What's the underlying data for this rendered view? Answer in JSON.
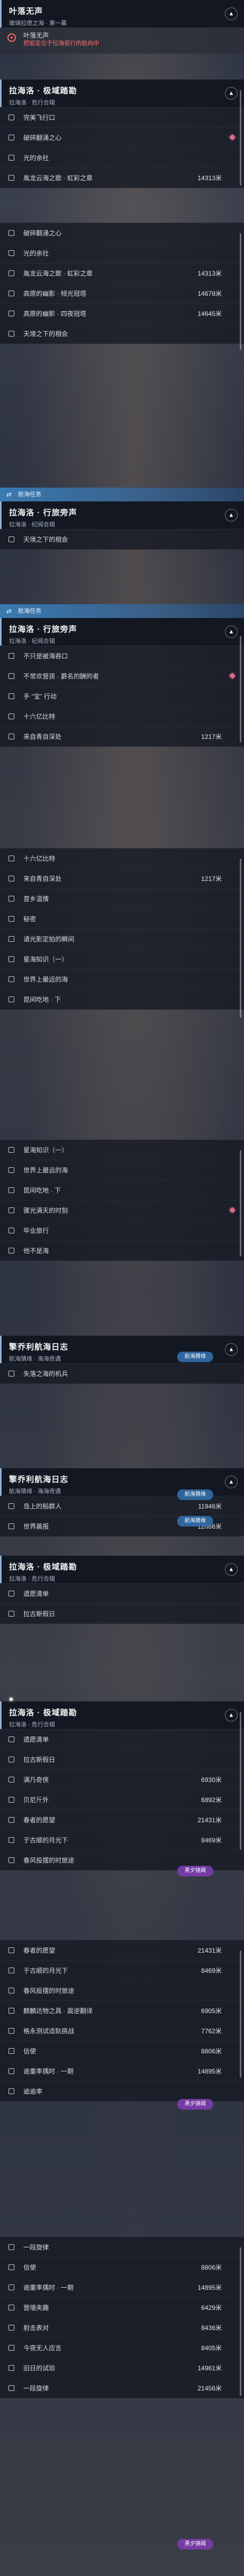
{
  "block1": {
    "title": "叶落无声",
    "subtitle": "玻璃拉德之海 · 第一幕",
    "rows": [
      {
        "label": "叶落无声",
        "sub": "把船定位于拉海若行的航向中",
        "type": "ring"
      },
      {
        "label": "",
        "type": "spacer"
      }
    ]
  },
  "block2": {
    "title": "拉海洛 · 极域踏勘",
    "subtitle": "拉海洛 · 危行合辑",
    "rows": [
      {
        "label": "完美飞行口"
      },
      {
        "label": "破碎翻涌之心",
        "diamond": true
      },
      {
        "label": "光的余社"
      },
      {
        "label": "胤龙云海之歌 · 虹彩之章",
        "dist": "14313米"
      }
    ]
  },
  "block3": {
    "rows": [
      {
        "label": "破碎翻涌之心"
      },
      {
        "label": "光的余社"
      },
      {
        "label": "胤龙云海之歌 · 虹彩之章",
        "dist": "14313米"
      },
      {
        "label": "高原的幽影 · 倾光冠塔",
        "dist": "14678米"
      },
      {
        "label": "高原的幽影 · 四夜冠塔",
        "dist": "14645米"
      },
      {
        "label": "天境之下的相会"
      }
    ]
  },
  "tag1": "航海任务",
  "block4": {
    "title": "拉海洛 · 行旅旁声",
    "subtitle": "拉海洛 · 纪闻合辑",
    "rows": [
      {
        "label": "天境之下的相会"
      }
    ]
  },
  "tag2": "航海任务",
  "block5": {
    "title": "拉海洛 · 行旅旁声",
    "subtitle": "拉海洛 · 纪闻合辑",
    "rows": [
      {
        "label": "不只是被海吞口"
      },
      {
        "label": "不常欢营孩 · 爵名的酬的者",
        "diamond": true
      },
      {
        "label": "手 “宝” 行动"
      },
      {
        "label": "十六亿比特"
      },
      {
        "label": "来自青自深处",
        "dist": "1217米"
      }
    ]
  },
  "block6": {
    "rows": [
      {
        "label": "十六亿比特"
      },
      {
        "label": "来自青自深处",
        "dist": "1217米"
      },
      {
        "label": "昔乡温情"
      },
      {
        "label": "秘密"
      },
      {
        "label": "请光影定拍的瞬间"
      },
      {
        "label": "星海知识（一）"
      },
      {
        "label": "世界上最远的海"
      },
      {
        "label": "昆间吃地 · 下"
      }
    ]
  },
  "block7": {
    "rows": [
      {
        "label": "星海知识（一）"
      },
      {
        "label": "世界上最远的海"
      },
      {
        "label": "昆间吃地 · 下"
      },
      {
        "label": "骤光满天的时刻",
        "diamond": true
      },
      {
        "label": "毕业旅行"
      },
      {
        "label": "他不是海"
      }
    ]
  },
  "block8": {
    "title": "擎乔利航海日志",
    "subtitle": "航海猜缘 · 海海奇遇",
    "badge": "航海猜缘",
    "rows": [
      {
        "label": "失落之海的机兵"
      }
    ]
  },
  "block9": {
    "title": "擎乔利航海日志",
    "subtitle": "航海猜缘 · 海海奇遇",
    "badge1": "航海猜缘",
    "badge2": "航海猜缘",
    "rows": [
      {
        "label": "岛上的船群人",
        "dist": "11946米"
      },
      {
        "label": "世界晨报",
        "dist": "12066米"
      }
    ]
  },
  "block10": {
    "title": "拉海洛 · 极域踏勘",
    "subtitle": "拉海洛 · 危行合辑",
    "rows": [
      {
        "label": "遗愿清单"
      },
      {
        "label": "拉古斯假日"
      }
    ]
  },
  "block11": {
    "title": "拉海洛 · 极域踏勘",
    "subtitle": "拉海洛 · 危行合辑",
    "badge": "黑夕镜阈",
    "rows": [
      {
        "label": "遗愿清单"
      },
      {
        "label": "拉古斯假日"
      },
      {
        "label": "满乃奇侠",
        "dist": "6930米"
      },
      {
        "label": "贝尼斤外",
        "dist": "6892米"
      },
      {
        "label": "春者的愿望",
        "dist": "21431米"
      },
      {
        "label": "于古顺的月光下",
        "dist": "8469米"
      },
      {
        "label": "春风投摆的时旅途"
      }
    ]
  },
  "block12": {
    "badge": "黑夕镜阈",
    "rows": [
      {
        "label": "春者的愿望",
        "dist": "21431米"
      },
      {
        "label": "于古顺的月光下",
        "dist": "8469米"
      },
      {
        "label": "春风投摆的时旅途"
      },
      {
        "label": "麒麟达物之具 · 腐逆翻译",
        "dist": "6905米"
      },
      {
        "label": "格永测试适轨挑战",
        "dist": "7762米"
      },
      {
        "label": "信使",
        "dist": "8806米"
      },
      {
        "label": "逾重率偶时 · 一期",
        "dist": "14895米"
      },
      {
        "label": "逾逾率"
      }
    ]
  },
  "block13": {
    "badge": "黑夕镜阈",
    "rows": [
      {
        "label": "一段旋律"
      },
      {
        "label": "信使",
        "dist": "8806米"
      },
      {
        "label": "逾重率偶时 · 一期",
        "dist": "14895米"
      },
      {
        "label": "营墙夹趣",
        "dist": "6429米"
      },
      {
        "label": "射击表对",
        "dist": "8436米"
      },
      {
        "label": "今夜无人应言",
        "dist": "8405米"
      },
      {
        "label": "旧日的试验",
        "dist": "14961米"
      },
      {
        "label": "一段旋律",
        "dist": "21456米"
      }
    ]
  }
}
